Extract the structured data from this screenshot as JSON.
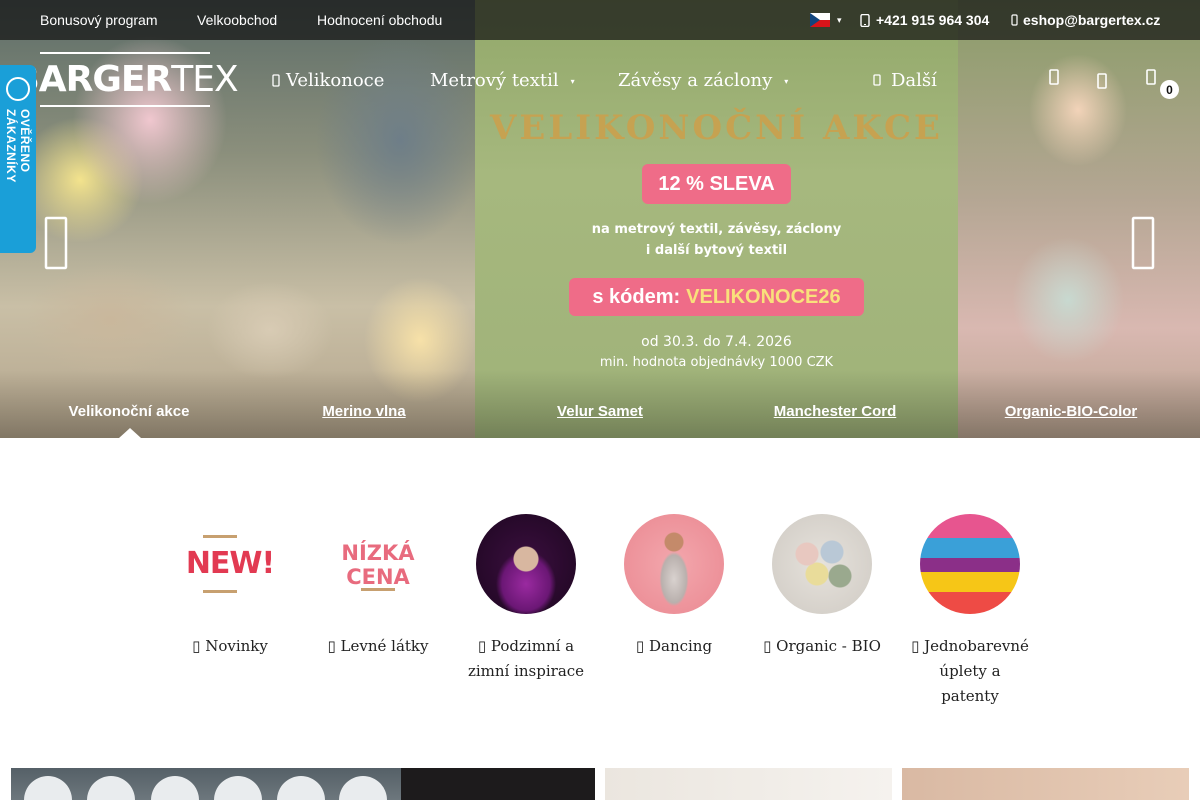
{
  "topbar": {
    "links": [
      "Bonusový program",
      "Velkoobchod",
      "Hodnocení obchodu"
    ],
    "phone": "+421 915 964 304",
    "email": "eshop@bargertex.cz",
    "language": "CZ"
  },
  "logo": {
    "part1": "BARGER",
    "part2": "TEX"
  },
  "nav": {
    "items": [
      "Velikonoce",
      "Metrový textil",
      "Závěsy a záclony",
      "Další"
    ]
  },
  "header": {
    "cart_count": "0"
  },
  "verified_badge": {
    "text": "OVĚŘENO ZÁKAZNÍKY"
  },
  "promo": {
    "title": "VELIKONOČNÍ AKCE",
    "discount": "12 % SLEVA",
    "line1": "na metrový textil, závěsy, záclony",
    "line2": "i další bytový textil",
    "code_prefix": "s kódem:",
    "code": "VELIKONOCE26",
    "dates": "od 30.3. do 7.4. 2026",
    "min_order": "min. hodnota objednávky 1000 CZK"
  },
  "slider": {
    "tabs": [
      "Velikonoční akce",
      "Merino vlna",
      "Velur Samet",
      "Manchester Cord",
      "Organic-BIO-Color"
    ],
    "active_index": 0
  },
  "categories": [
    {
      "label": "Novinky",
      "icon_text": "NEW!"
    },
    {
      "label": "Levné látky",
      "icon_text_1": "NÍZKÁ",
      "icon_text_2": "CENA"
    },
    {
      "label": "Podzimní a zimní inspirace"
    },
    {
      "label": "Dancing"
    },
    {
      "label": "Organic - BIO"
    },
    {
      "label": "Jednobarevné úplety a patenty"
    }
  ],
  "colors": {
    "promo_pink": "#ef6c88",
    "promo_gold": "#c6a251",
    "code_yellow": "#f9e07b",
    "verified_blue": "#1a9fd8"
  }
}
